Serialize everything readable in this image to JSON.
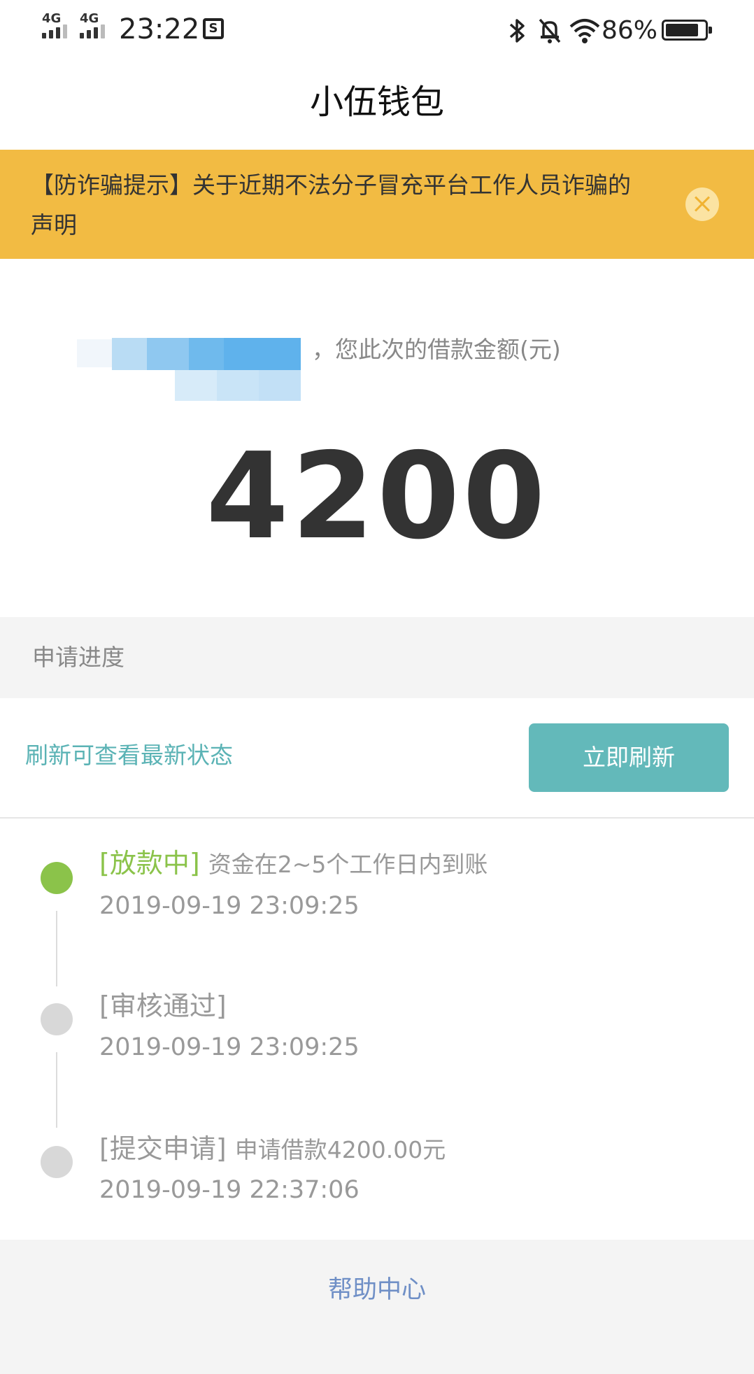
{
  "status_bar": {
    "network_1": "4G",
    "network_2": "4G",
    "time": "23:22",
    "battery_percent": "86%",
    "battery_level": 0.86,
    "screenshot_icon": "S"
  },
  "header": {
    "title": "小伍钱包"
  },
  "notice": {
    "text": "【防诈骗提示】关于近期不法分子冒充平台工作人员诈骗的声明",
    "close_icon": "close-icon"
  },
  "amount_section": {
    "label": "，您此次的借款金额(元)",
    "amount": "4200"
  },
  "progress": {
    "heading": "申请进度",
    "refresh_hint": "刷新可查看最新状态",
    "refresh_button": "立即刷新"
  },
  "timeline": [
    {
      "title": "[放款中]",
      "desc": "资金在2~5个工作日内到账",
      "time": "2019-09-19 23:09:25",
      "active": true
    },
    {
      "title": "[审核通过]",
      "desc": "",
      "time": "2019-09-19 23:09:25",
      "active": false
    },
    {
      "title": "[提交申请]",
      "desc": "申请借款4200.00元",
      "time": "2019-09-19 22:37:06",
      "active": false
    }
  ],
  "colors": {
    "notice_bg": "#f2bb43",
    "accent_teal": "#63b9ba",
    "active_green": "#8bc34a",
    "link_blue": "#6f8fc6"
  },
  "footer": {
    "help_link": "帮助中心"
  }
}
